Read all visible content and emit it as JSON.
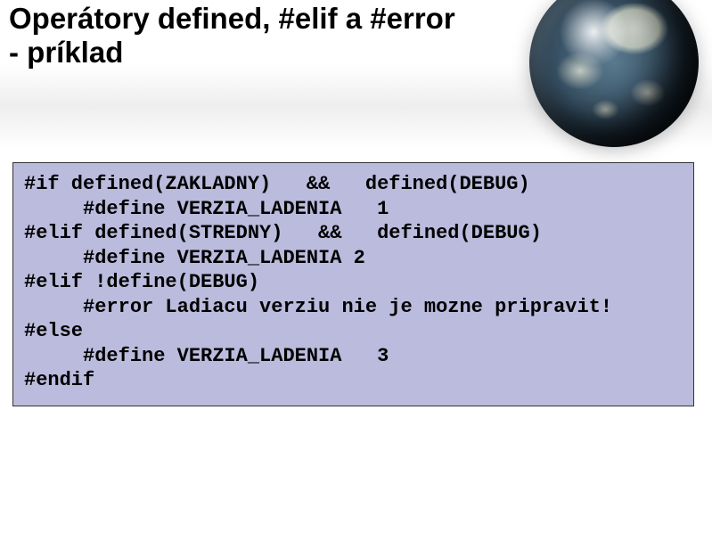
{
  "slide": {
    "title": "Operátory defined, #elif a #error\n- príklad",
    "code": "#if defined(ZAKLADNY)   &&   defined(DEBUG)\n     #define VERZIA_LADENIA   1\n#elif defined(STREDNY)   &&   defined(DEBUG)\n     #define VERZIA_LADENIA 2\n#elif !define(DEBUG)\n     #error Ladiacu verziu nie je mozne pripravit!\n#else\n     #define VERZIA_LADENIA   3\n#endif"
  }
}
